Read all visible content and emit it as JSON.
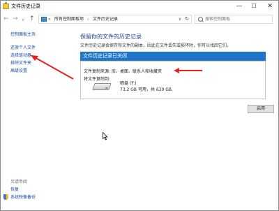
{
  "window": {
    "title": "文件历史记录"
  },
  "controls": {
    "minimize": "—",
    "maximize": "☐",
    "close": "✕"
  },
  "nav": {
    "back": "←",
    "forward": "→",
    "history": "∨",
    "up": "↑",
    "breadcrumb_prefix": "«",
    "breadcrumb": [
      "所有控制面板项",
      "文件历史记录"
    ],
    "separator": "›",
    "search_placeholder": "搜索控制面板"
  },
  "sidebar": {
    "items": [
      "控制面板主页",
      "还原个人文件",
      "选择驱动器",
      "排除文件夹",
      "高级设置"
    ],
    "see_also_title": "另请参阅",
    "see_also": [
      "恢复",
      "系统映像备份"
    ]
  },
  "main": {
    "title": "保留你的文件的历史记录",
    "description": "文件历史记录会保存你文件的副本，因此在文件丢失或损坏时，你可以找回它们。",
    "status": "文件历史记录已关闭",
    "source_label": "文件复制来源:",
    "source_value": "库、桌面、联系人和收藏夹",
    "destination_label": "将文件复制到:",
    "drive_name": "硒盘 (F:)",
    "drive_space": "73.2 GB 可用，共 630 GB",
    "apply_button": "启用"
  },
  "colors": {
    "status_banner": "#1f75c7",
    "link": "#1a4aa0",
    "title": "#1e3f8a",
    "annotation_arrow": "#e8211d"
  },
  "icons": [
    "app-icon",
    "folder-icon",
    "search-icon",
    "refresh-icon",
    "drive-icon",
    "shield-icon",
    "mouse-cursor-icon"
  ]
}
